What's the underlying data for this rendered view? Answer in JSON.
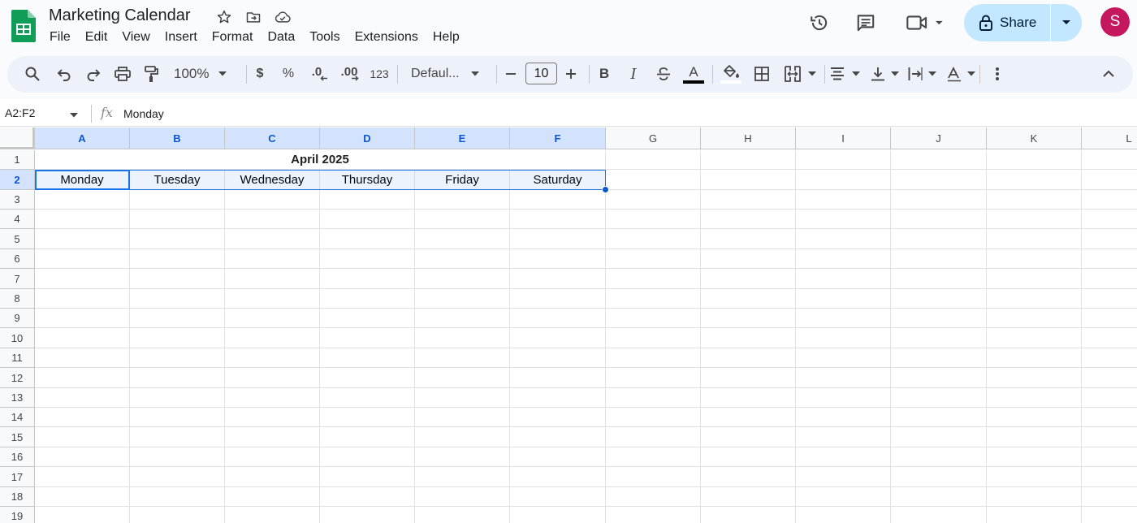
{
  "app": {
    "doc_title": "Marketing Calendar",
    "menu": [
      "File",
      "Edit",
      "View",
      "Insert",
      "Format",
      "Data",
      "Tools",
      "Extensions",
      "Help"
    ],
    "share_label": "Share",
    "avatar_letter": "S",
    "colors": {
      "accent": "#0b57d0",
      "share_bg": "#c2e7ff",
      "avatar_bg": "#c5175e",
      "sheets_green": "#0f9d58"
    }
  },
  "toolbar": {
    "zoom": "100%",
    "currency": "$",
    "percent": "%",
    "decrease_decimal": ".0",
    "increase_decimal": ".00",
    "number_format": "123",
    "font": "Defaul...",
    "font_size": "10",
    "bold": "B",
    "italic": "I",
    "text_color_letter": "A",
    "icons": [
      "search-icon",
      "undo-icon",
      "redo-icon",
      "print-icon",
      "paint-format-icon",
      "strikethrough-icon",
      "fill-color-icon",
      "borders-icon",
      "merge-icon",
      "align-icon",
      "valign-icon",
      "wrap-icon",
      "rotate-icon",
      "more-icon",
      "collapse-icon"
    ]
  },
  "formula_bar": {
    "name_box": "A2:F2",
    "fx": "fx",
    "value": "Monday"
  },
  "sheet": {
    "columns": [
      "A",
      "B",
      "C",
      "D",
      "E",
      "F",
      "G",
      "H",
      "I",
      "J",
      "K",
      "L"
    ],
    "rows": [
      "1",
      "2",
      "3",
      "4",
      "5",
      "6",
      "7",
      "8",
      "9",
      "10",
      "11",
      "12",
      "13",
      "14",
      "15",
      "16",
      "17",
      "18",
      "19"
    ],
    "title_cell": "April 2025",
    "weekdays": [
      "Monday",
      "Tuesday",
      "Wednesday",
      "Thursday",
      "Friday",
      "Saturday"
    ]
  }
}
